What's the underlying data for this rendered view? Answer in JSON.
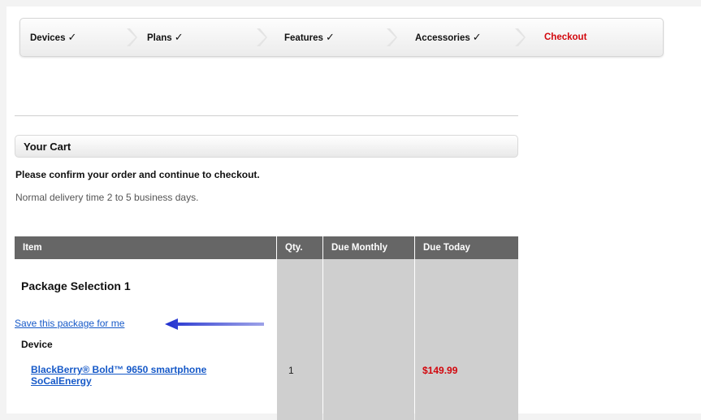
{
  "steps": [
    {
      "label": "Devices",
      "done": true
    },
    {
      "label": "Plans",
      "done": true
    },
    {
      "label": "Features",
      "done": true
    },
    {
      "label": "Accessories",
      "done": true
    },
    {
      "label": "Checkout",
      "done": false
    }
  ],
  "check_mark": "✓",
  "cart": {
    "title": "Your Cart",
    "confirm_text": "Please confirm your order and continue to checkout.",
    "delivery_text": "Normal delivery time 2 to 5 business days."
  },
  "table": {
    "headers": [
      "Item",
      "Qty.",
      "Due Monthly",
      "Due Today"
    ]
  },
  "package": {
    "title": "Package Selection 1",
    "save_link": "Save this package for me",
    "device_label": "Device",
    "device_name_line1": "BlackBerry® Bold™ 9650 smartphone",
    "device_name_line2": "SoCalEnergy",
    "qty": "1",
    "due_monthly": "",
    "due_today": "$149.99"
  },
  "colors": {
    "accent_red": "#d2070d",
    "link_blue": "#1659c8",
    "header_grey": "#666666",
    "column_grey": "#cfcfcf",
    "arrow_blue": "#1f2fcf"
  }
}
